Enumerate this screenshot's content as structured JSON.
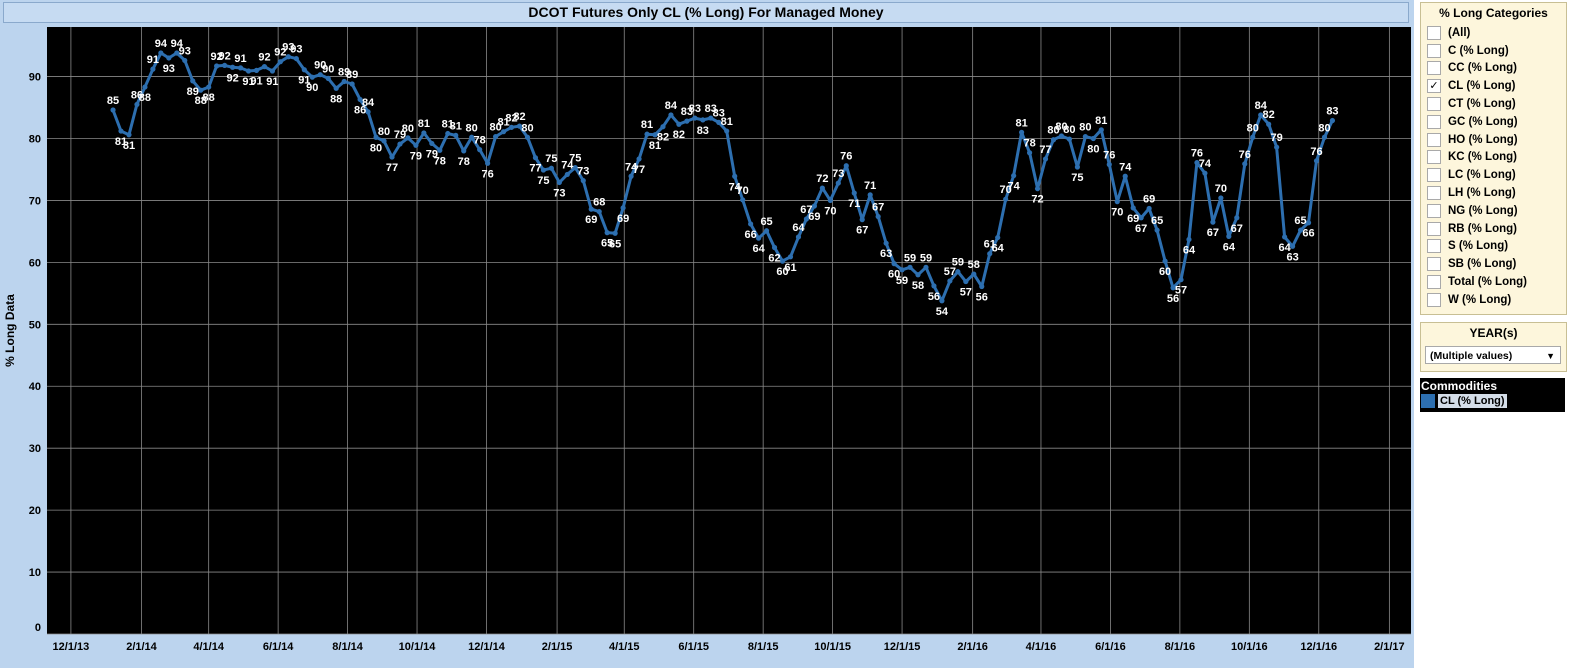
{
  "title": "DCOT Futures Only CL (% Long) For Managed Money",
  "colors": {
    "series": "#2d6fb0",
    "plot_bg": "#000000",
    "panel_bg": "#bcd4ee"
  },
  "categories_panel": {
    "title": "% Long Categories",
    "items": [
      {
        "label": "(All)",
        "checked": false
      },
      {
        "label": "C (% Long)",
        "checked": false
      },
      {
        "label": "CC (% Long)",
        "checked": false
      },
      {
        "label": "CL (% Long)",
        "checked": true
      },
      {
        "label": "CT (% Long)",
        "checked": false
      },
      {
        "label": "GC (% Long)",
        "checked": false
      },
      {
        "label": "HO (% Long)",
        "checked": false
      },
      {
        "label": "KC (% Long)",
        "checked": false
      },
      {
        "label": "LC (% Long)",
        "checked": false
      },
      {
        "label": "LH (% Long)",
        "checked": false
      },
      {
        "label": "NG (% Long)",
        "checked": false
      },
      {
        "label": "RB (% Long)",
        "checked": false
      },
      {
        "label": "S (% Long)",
        "checked": false
      },
      {
        "label": "SB (% Long)",
        "checked": false
      },
      {
        "label": "Total (% Long)",
        "checked": false
      },
      {
        "label": "W (% Long)",
        "checked": false
      }
    ]
  },
  "year_panel": {
    "title": "YEAR(s)",
    "value": "(Multiple values)"
  },
  "legend": {
    "title": "Commodities",
    "items": [
      {
        "label": "CL (% Long)",
        "color": "#2d6fb0"
      }
    ]
  },
  "chart_data": {
    "type": "line",
    "title": "DCOT Futures Only CL (% Long) For Managed Money",
    "xlabel": "",
    "ylabel": "% Long Data",
    "ylim": [
      0,
      98
    ],
    "yticks": [
      0,
      10,
      20,
      30,
      40,
      50,
      60,
      70,
      80,
      90
    ],
    "xlim": [
      "2013-11-10",
      "2017-02-20"
    ],
    "xticks": [
      "12/1/13",
      "2/1/14",
      "4/1/14",
      "6/1/14",
      "8/1/14",
      "10/1/14",
      "12/1/14",
      "2/1/15",
      "4/1/15",
      "6/1/15",
      "8/1/15",
      "10/1/15",
      "12/1/15",
      "2/1/16",
      "4/1/16",
      "6/1/16",
      "8/1/16",
      "10/1/16",
      "12/1/16",
      "2/1/17"
    ],
    "xtick_dates": [
      "2013-12-01",
      "2014-02-01",
      "2014-04-01",
      "2014-06-01",
      "2014-08-01",
      "2014-10-01",
      "2014-12-01",
      "2015-02-01",
      "2015-04-01",
      "2015-06-01",
      "2015-08-01",
      "2015-10-01",
      "2015-12-01",
      "2016-02-01",
      "2016-04-01",
      "2016-06-01",
      "2016-08-01",
      "2016-10-01",
      "2016-12-01",
      "2017-02-01"
    ],
    "grid": true,
    "legend_position": "right",
    "series": [
      {
        "name": "CL (% Long)",
        "color": "#2d6fb0",
        "points": [
          [
            "2014-01-07",
            84.6
          ],
          [
            "2014-01-14",
            81.2
          ],
          [
            "2014-01-21",
            80.6
          ],
          [
            "2014-01-28",
            85.5
          ],
          [
            "2014-02-04",
            88.3
          ],
          [
            "2014-02-11",
            91.2
          ],
          [
            "2014-02-18",
            93.8
          ],
          [
            "2014-02-25",
            93.0
          ],
          [
            "2014-03-04",
            93.8
          ],
          [
            "2014-03-11",
            92.6
          ],
          [
            "2014-03-18",
            89.3
          ],
          [
            "2014-03-25",
            87.8
          ],
          [
            "2014-04-01",
            88.3
          ],
          [
            "2014-04-08",
            91.7
          ],
          [
            "2014-04-15",
            91.8
          ],
          [
            "2014-04-22",
            91.5
          ],
          [
            "2014-04-29",
            91.4
          ],
          [
            "2014-05-06",
            90.9
          ],
          [
            "2014-05-13",
            91.0
          ],
          [
            "2014-05-20",
            91.6
          ],
          [
            "2014-05-27",
            90.9
          ],
          [
            "2014-06-03",
            92.4
          ],
          [
            "2014-06-10",
            93.2
          ],
          [
            "2014-06-17",
            92.9
          ],
          [
            "2014-06-24",
            91.1
          ],
          [
            "2014-07-01",
            89.9
          ],
          [
            "2014-07-08",
            90.3
          ],
          [
            "2014-07-15",
            89.7
          ],
          [
            "2014-07-22",
            88.1
          ],
          [
            "2014-07-29",
            89.2
          ],
          [
            "2014-08-05",
            88.8
          ],
          [
            "2014-08-12",
            86.3
          ],
          [
            "2014-08-19",
            84.3
          ],
          [
            "2014-08-26",
            80.2
          ],
          [
            "2014-09-02",
            79.6
          ],
          [
            "2014-09-09",
            77.0
          ],
          [
            "2014-09-16",
            79.1
          ],
          [
            "2014-09-23",
            80.1
          ],
          [
            "2014-09-30",
            78.9
          ],
          [
            "2014-10-07",
            80.9
          ],
          [
            "2014-10-14",
            79.2
          ],
          [
            "2014-10-21",
            78.1
          ],
          [
            "2014-10-28",
            80.8
          ],
          [
            "2014-11-04",
            80.5
          ],
          [
            "2014-11-11",
            78.0
          ],
          [
            "2014-11-18",
            80.2
          ],
          [
            "2014-11-25",
            78.2
          ],
          [
            "2014-12-02",
            76.0
          ],
          [
            "2014-12-09",
            80.3
          ],
          [
            "2014-12-16",
            81.1
          ],
          [
            "2014-12-23",
            81.8
          ],
          [
            "2014-12-30",
            82.0
          ],
          [
            "2015-01-06",
            80.2
          ],
          [
            "2015-01-13",
            76.9
          ],
          [
            "2015-01-20",
            74.9
          ],
          [
            "2015-01-27",
            75.2
          ],
          [
            "2015-02-03",
            72.9
          ],
          [
            "2015-02-10",
            74.2
          ],
          [
            "2015-02-17",
            75.3
          ],
          [
            "2015-02-24",
            73.2
          ],
          [
            "2015-03-03",
            68.6
          ],
          [
            "2015-03-10",
            68.2
          ],
          [
            "2015-03-17",
            64.8
          ],
          [
            "2015-03-24",
            64.7
          ],
          [
            "2015-03-31",
            68.8
          ],
          [
            "2015-04-07",
            73.9
          ],
          [
            "2015-04-14",
            76.7
          ],
          [
            "2015-04-21",
            80.7
          ],
          [
            "2015-04-28",
            80.6
          ],
          [
            "2015-05-05",
            81.9
          ],
          [
            "2015-05-12",
            83.8
          ],
          [
            "2015-05-19",
            82.3
          ],
          [
            "2015-05-26",
            82.8
          ],
          [
            "2015-06-02",
            83.3
          ],
          [
            "2015-06-09",
            83.0
          ],
          [
            "2015-06-16",
            83.3
          ],
          [
            "2015-06-23",
            82.6
          ],
          [
            "2015-06-30",
            81.2
          ],
          [
            "2015-07-07",
            73.9
          ],
          [
            "2015-07-14",
            70.1
          ],
          [
            "2015-07-21",
            66.2
          ],
          [
            "2015-07-28",
            63.9
          ],
          [
            "2015-08-04",
            65.1
          ],
          [
            "2015-08-11",
            62.4
          ],
          [
            "2015-08-18",
            60.2
          ],
          [
            "2015-08-25",
            60.9
          ],
          [
            "2015-09-01",
            64.1
          ],
          [
            "2015-09-08",
            67.0
          ],
          [
            "2015-09-15",
            69.1
          ],
          [
            "2015-09-22",
            72.0
          ],
          [
            "2015-09-29",
            70.0
          ],
          [
            "2015-10-06",
            72.8
          ],
          [
            "2015-10-13",
            75.6
          ],
          [
            "2015-10-20",
            71.2
          ],
          [
            "2015-10-27",
            66.9
          ],
          [
            "2015-11-03",
            70.9
          ],
          [
            "2015-11-10",
            67.4
          ],
          [
            "2015-11-17",
            63.1
          ],
          [
            "2015-11-24",
            59.8
          ],
          [
            "2015-12-01",
            58.8
          ],
          [
            "2015-12-08",
            59.2
          ],
          [
            "2015-12-15",
            58.0
          ],
          [
            "2015-12-22",
            59.2
          ],
          [
            "2015-12-29",
            56.2
          ],
          [
            "2016-01-05",
            53.8
          ],
          [
            "2016-01-12",
            57.0
          ],
          [
            "2016-01-19",
            58.5
          ],
          [
            "2016-01-26",
            56.9
          ],
          [
            "2016-02-02",
            58.1
          ],
          [
            "2016-02-09",
            56.1
          ],
          [
            "2016-02-16",
            61.4
          ],
          [
            "2016-02-23",
            64.0
          ],
          [
            "2016-03-01",
            70.2
          ],
          [
            "2016-03-08",
            74.0
          ],
          [
            "2016-03-15",
            81.0
          ],
          [
            "2016-03-22",
            77.7
          ],
          [
            "2016-03-29",
            71.9
          ],
          [
            "2016-04-05",
            76.7
          ],
          [
            "2016-04-12",
            79.8
          ],
          [
            "2016-04-19",
            80.4
          ],
          [
            "2016-04-26",
            79.9
          ],
          [
            "2016-05-03",
            75.4
          ],
          [
            "2016-05-10",
            80.3
          ],
          [
            "2016-05-17",
            80.0
          ],
          [
            "2016-05-24",
            81.4
          ],
          [
            "2016-05-31",
            75.8
          ],
          [
            "2016-06-07",
            69.8
          ],
          [
            "2016-06-14",
            73.9
          ],
          [
            "2016-06-21",
            68.8
          ],
          [
            "2016-06-28",
            67.2
          ],
          [
            "2016-07-05",
            68.7
          ],
          [
            "2016-07-12",
            65.2
          ],
          [
            "2016-07-19",
            60.2
          ],
          [
            "2016-07-26",
            55.9
          ],
          [
            "2016-08-02",
            57.2
          ],
          [
            "2016-08-09",
            63.7
          ],
          [
            "2016-08-16",
            76.1
          ],
          [
            "2016-08-23",
            74.4
          ],
          [
            "2016-08-30",
            66.5
          ],
          [
            "2016-09-06",
            70.4
          ],
          [
            "2016-09-13",
            64.2
          ],
          [
            "2016-09-20",
            67.2
          ],
          [
            "2016-09-27",
            75.9
          ],
          [
            "2016-10-04",
            80.2
          ],
          [
            "2016-10-11",
            83.8
          ],
          [
            "2016-10-18",
            82.3
          ],
          [
            "2016-10-25",
            78.6
          ],
          [
            "2016-11-01",
            64.1
          ],
          [
            "2016-11-08",
            62.6
          ],
          [
            "2016-11-15",
            65.2
          ],
          [
            "2016-11-22",
            66.4
          ],
          [
            "2016-11-29",
            76.4
          ],
          [
            "2016-12-06",
            80.2
          ],
          [
            "2016-12-13",
            82.9
          ]
        ]
      }
    ]
  }
}
